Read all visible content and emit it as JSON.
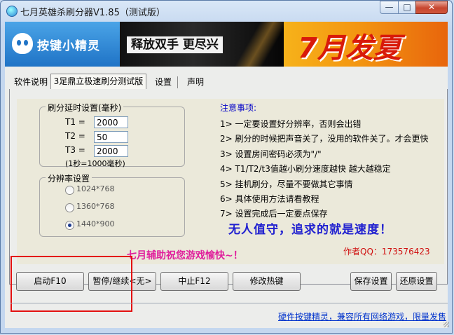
{
  "window": {
    "title": "七月英雄杀刷分器V1.85（测试版）",
    "min": "—",
    "max": "□",
    "close": "✕"
  },
  "banner": {
    "logo_text": "按键小精灵",
    "ad1_text": "释放双手 更尽兴",
    "ad2_text": "7月发夏"
  },
  "tabs": [
    "软件说明",
    "3足鼎立极速刷分测试版",
    "设置",
    "声明"
  ],
  "delay_group": {
    "title": "刷分延时设置(毫秒)",
    "fields": [
      {
        "label": "T1 =",
        "value": "2000"
      },
      {
        "label": "T2 =",
        "value": "50"
      },
      {
        "label": "T3 =",
        "value": "2000"
      }
    ],
    "note": "(1秒=1000毫秒)"
  },
  "resolution_group": {
    "title": "分辨率设置",
    "options": [
      {
        "label": "1024*768",
        "selected": false
      },
      {
        "label": "1360*768",
        "selected": false
      },
      {
        "label": "1440*900",
        "selected": true
      }
    ]
  },
  "notes": {
    "title": "注意事项:",
    "items": [
      "1> 一定要设置好分辨率，否则会出错",
      "2> 刷分的时候把声音关了，没用的软件关了。才会更快",
      "3> 设置房间密码必须为\"/\"",
      "4> T1/T2/t3值越小刷分速度越快 越大越稳定",
      "5> 挂机刷分，尽量不要做其它事情",
      "6> 具体使用方法请看教程",
      "7> 设置完成后一定要点保存"
    ],
    "slogan": "无人值守，追求的就是速度！",
    "qq": "作者QQ：173576423"
  },
  "blessing": "七月辅助祝您游戏愉快~！",
  "buttons": {
    "start": "启动F10",
    "pause": "暂停/继续<无>",
    "stop": "中止F12",
    "hotkey": "修改热键",
    "save": "保存设置",
    "restore": "还原设置"
  },
  "footer_link": "硬件按键精灵，兼容所有网络游戏，限量发售",
  "colors": {
    "notes_title": "#0000c8",
    "slogan": "#2020d0",
    "qq": "#d01010",
    "blessing": "#e01e9c",
    "highlight_box": "#e31010"
  }
}
